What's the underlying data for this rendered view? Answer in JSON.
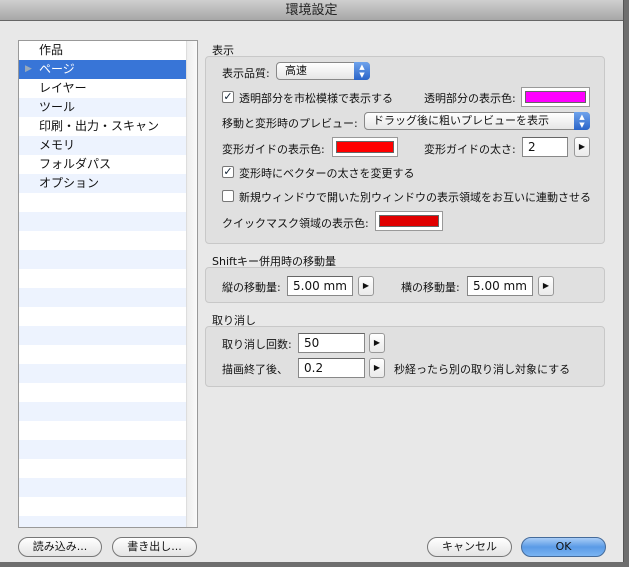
{
  "window": {
    "title": "環境設定"
  },
  "sidebar": {
    "items": [
      {
        "label": "作品"
      },
      {
        "label": "ページ",
        "selected": true
      },
      {
        "label": "レイヤー"
      },
      {
        "label": "ツール"
      },
      {
        "label": "印刷・出力・スキャン"
      },
      {
        "label": "メモリ"
      },
      {
        "label": "フォルダパス"
      },
      {
        "label": "オプション"
      }
    ]
  },
  "display": {
    "heading": "表示",
    "quality_label": "表示品質:",
    "quality_value": "高速",
    "checker_label": "透明部分を市松模様で表示する",
    "checker_checked": true,
    "transparent_color_label": "透明部分の表示色:",
    "transparent_color": "#ff00ff",
    "preview_label": "移動と変形時のプレビュー:",
    "preview_value": "ドラッグ後に粗いプレビューを表示",
    "guide_color_label": "変形ガイドの表示色:",
    "guide_color": "#ff0000",
    "guide_width_label": "変形ガイドの太さ:",
    "guide_width": "2",
    "vector_label": "変形時にベクターの太さを変更する",
    "vector_checked": true,
    "link_label": "新規ウィンドウで開いた別ウィンドウの表示領域をお互いに連動させる",
    "link_checked": false,
    "quickmask_label": "クイックマスク領域の表示色:",
    "quickmask_color": "#e00000"
  },
  "shift": {
    "heading": "Shiftキー併用時の移動量",
    "vertical_label": "縦の移動量:",
    "vertical_value": "5.00 mm",
    "horizontal_label": "横の移動量:",
    "horizontal_value": "5.00 mm"
  },
  "undo": {
    "heading": "取り消し",
    "count_label": "取り消し回数:",
    "count_value": "50",
    "after_label": "描画終了後、",
    "after_value": "0.2",
    "after_suffix": "秒経ったら別の取り消し対象にする"
  },
  "buttons": {
    "import": "読み込み...",
    "export": "書き出し...",
    "cancel": "キャンセル",
    "ok": "OK"
  },
  "colors": {
    "selection": "#3875d7",
    "accent": "#5b9be6"
  }
}
